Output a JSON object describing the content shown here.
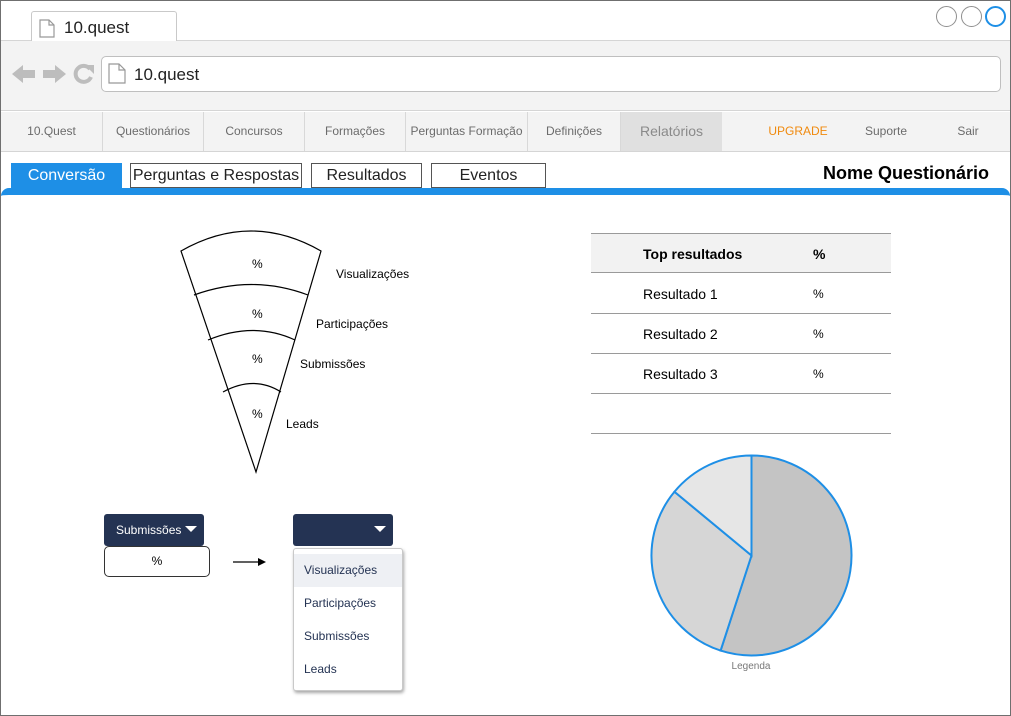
{
  "browser": {
    "tab_title": "10.quest",
    "url": "10.quest"
  },
  "menu": {
    "items": [
      {
        "label": "10.Quest"
      },
      {
        "label": "Questionários"
      },
      {
        "label": "Concursos"
      },
      {
        "label": "Formações"
      },
      {
        "label": "Perguntas Formação"
      },
      {
        "label": "Definições"
      },
      {
        "label": "Relatórios",
        "active": true
      },
      {
        "label": "UPGRADE"
      },
      {
        "label": "Suporte"
      },
      {
        "label": "Sair"
      }
    ]
  },
  "tabs": [
    {
      "label": "Conversão",
      "active": true
    },
    {
      "label": "Perguntas e Respostas"
    },
    {
      "label": "Resultados"
    },
    {
      "label": "Eventos"
    }
  ],
  "page_title": "Nome Questionário",
  "funnel": {
    "stages": [
      {
        "label": "Visualizações",
        "value": "%"
      },
      {
        "label": "Participações",
        "value": "%"
      },
      {
        "label": "Submissões",
        "value": "%"
      },
      {
        "label": "Leads",
        "value": "%"
      }
    ]
  },
  "compare": {
    "from_select": "Submissões",
    "from_value": "%",
    "to_select": "",
    "options": [
      "Visualizações",
      "Participações",
      "Submissões",
      "Leads"
    ]
  },
  "top_table": {
    "headers": [
      "Top resultados",
      "%"
    ],
    "rows": [
      [
        "Resultado 1",
        "%"
      ],
      [
        "Resultado 2",
        "%"
      ],
      [
        "Resultado 3",
        "%"
      ]
    ]
  },
  "chart_data": {
    "type": "pie",
    "slices": [
      {
        "value": 55,
        "color": "#c4c4c4"
      },
      {
        "value": 31,
        "color": "#d6d6d6"
      },
      {
        "value": 14,
        "color": "#e6e6e6"
      }
    ],
    "stroke_color": "#1e8fe6",
    "legend_label": "Legenda"
  },
  "colors": {
    "accent": "#1e8fe6",
    "navy": "#243353",
    "upgrade": "#f08a0e"
  }
}
